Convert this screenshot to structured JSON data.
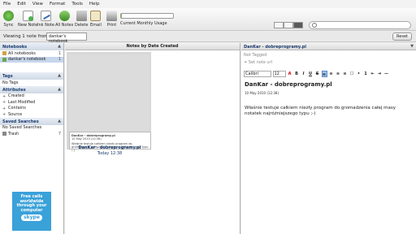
{
  "menu": [
    "File",
    "Edit",
    "View",
    "Format",
    "Tools",
    "Help"
  ],
  "toolbar": {
    "buttons": [
      {
        "label": "Sync",
        "icon": "sync-icon"
      },
      {
        "label": "New Note",
        "icon": "new-note-icon"
      },
      {
        "label": "Ink Note",
        "icon": "ink-note-icon"
      },
      {
        "label": "All Notes",
        "icon": "all-notes-icon"
      },
      {
        "label": "Delete",
        "icon": "delete-icon"
      },
      {
        "label": "Email",
        "icon": "email-icon"
      },
      {
        "label": "Print",
        "icon": "print-icon"
      }
    ],
    "usage_label": "Current Monthly Usage",
    "usage_fraction": 0.01
  },
  "filter": {
    "viewing_text": "Viewing 1 note from",
    "notebook": "dankar's notebook",
    "reset": "Reset"
  },
  "sidebar": {
    "notebooks_header": "Notebooks",
    "notebooks": [
      {
        "label": "All notebooks",
        "count": "1"
      },
      {
        "label": "dankar's notebook",
        "count": "1"
      }
    ],
    "tags_header": "Tags",
    "tags_empty": "No Tags",
    "attributes_header": "Attributes",
    "attributes": [
      "Created",
      "Last Modified",
      "Contains",
      "Source"
    ],
    "saved_header": "Saved Searches",
    "saved_empty": "No Saved Searches",
    "trash": {
      "label": "Trash",
      "count": "7"
    }
  },
  "ad": {
    "text": [
      "Free calls",
      "worldwide",
      "through your",
      "computer"
    ],
    "brand": "skype"
  },
  "notelist": {
    "header": "Notes by Date Created",
    "card": {
      "title": "DanKar - dobreprogramy.pl",
      "date": "Today 12:38",
      "preview_title": "DanKar - dobreprogramy.pl",
      "preview_date": "10 May 2010 (12:38)",
      "preview_body": "Właśnie testuje całkiem niezły program do gromadzenia całej masy notatek najróżniejszego typu ;-)"
    }
  },
  "editor": {
    "header": "DanKar - dobreprogramy.pl",
    "tags": "Not Tagged",
    "url_placeholder": "Set note url",
    "font": "Calibri",
    "size": "12",
    "title": "DanKar - dobreprogramy.pl",
    "date": "10 May 2010 (12:38)",
    "body": "Właśnie testuje całkiem niezły program do gromadzenia całej masy notatek najróżniejszego typu ;-)"
  }
}
